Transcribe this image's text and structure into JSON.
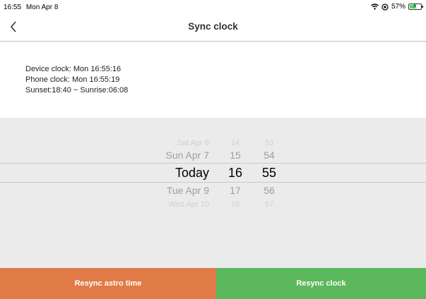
{
  "status": {
    "time": "16:55",
    "date": "Mon Apr 8",
    "battery": "57%",
    "battery_level": 0.57
  },
  "nav": {
    "title": "Sync clock",
    "back_icon": "chevron-left-icon"
  },
  "info": {
    "device_label": "Device clock:",
    "device_value": "Mon  16:55:16",
    "phone_label": "Phone  clock:",
    "phone_value": "Mon  16:55:19",
    "sun": "Sunset:18:40 ~ Sunrise:06:08"
  },
  "picker": {
    "days": [
      "Sat Apr 6",
      "Sun Apr 7",
      "Today",
      "Tue Apr 9",
      "Wed Apr 10"
    ],
    "hours": [
      "14",
      "15",
      "16",
      "17",
      "18"
    ],
    "minutes": [
      "53",
      "54",
      "55",
      "56",
      "57"
    ]
  },
  "buttons": {
    "astro_label": "Resync astro time",
    "astro_color": "#e07b48",
    "clock_label": "Resync clock",
    "clock_color": "#5cb85c"
  }
}
